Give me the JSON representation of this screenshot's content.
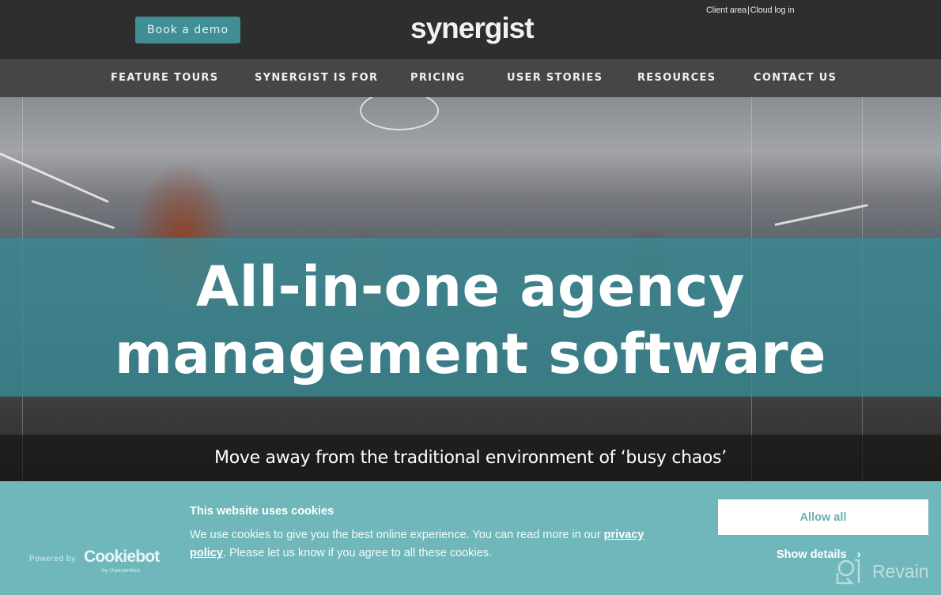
{
  "header": {
    "demo_button": "Book a demo",
    "logo_text": "synergist",
    "client_links": {
      "client_area": "Client area",
      "separator": "|",
      "cloud_login": "Cloud log in"
    }
  },
  "nav": {
    "items": [
      {
        "label": "FEATURE TOURS"
      },
      {
        "label": "SYNERGIST IS FOR"
      },
      {
        "label": "PRICING"
      },
      {
        "label": "USER STORIES"
      },
      {
        "label": "RESOURCES"
      },
      {
        "label": "CONTACT US"
      }
    ]
  },
  "hero": {
    "headline_line1": "All-in-one agency",
    "headline_line2": "management software",
    "subtitle": "Move away from the traditional environment of ‘busy chaos’"
  },
  "cookie_banner": {
    "powered_by": "Powered by",
    "provider_name": "Cookiebot",
    "provider_sub": "by Usercentrics",
    "title": "This website uses cookies",
    "text_before_link": "We use cookies to give you the best online experience.  You can read more in our ",
    "link_text": "privacy policy",
    "text_after_link": ".  Please let us know if you agree to all these cookies.",
    "allow_all": "Allow all",
    "show_details": "Show details",
    "show_details_icon": "chevron-right-icon"
  },
  "watermark": {
    "text": "Revain"
  },
  "colors": {
    "header_bg": "#2e2e2e",
    "nav_bg": "#464646",
    "accent_teal": "#3f8f95",
    "cookie_bg": "#6fb7bb",
    "hero_band": "#388c96"
  }
}
